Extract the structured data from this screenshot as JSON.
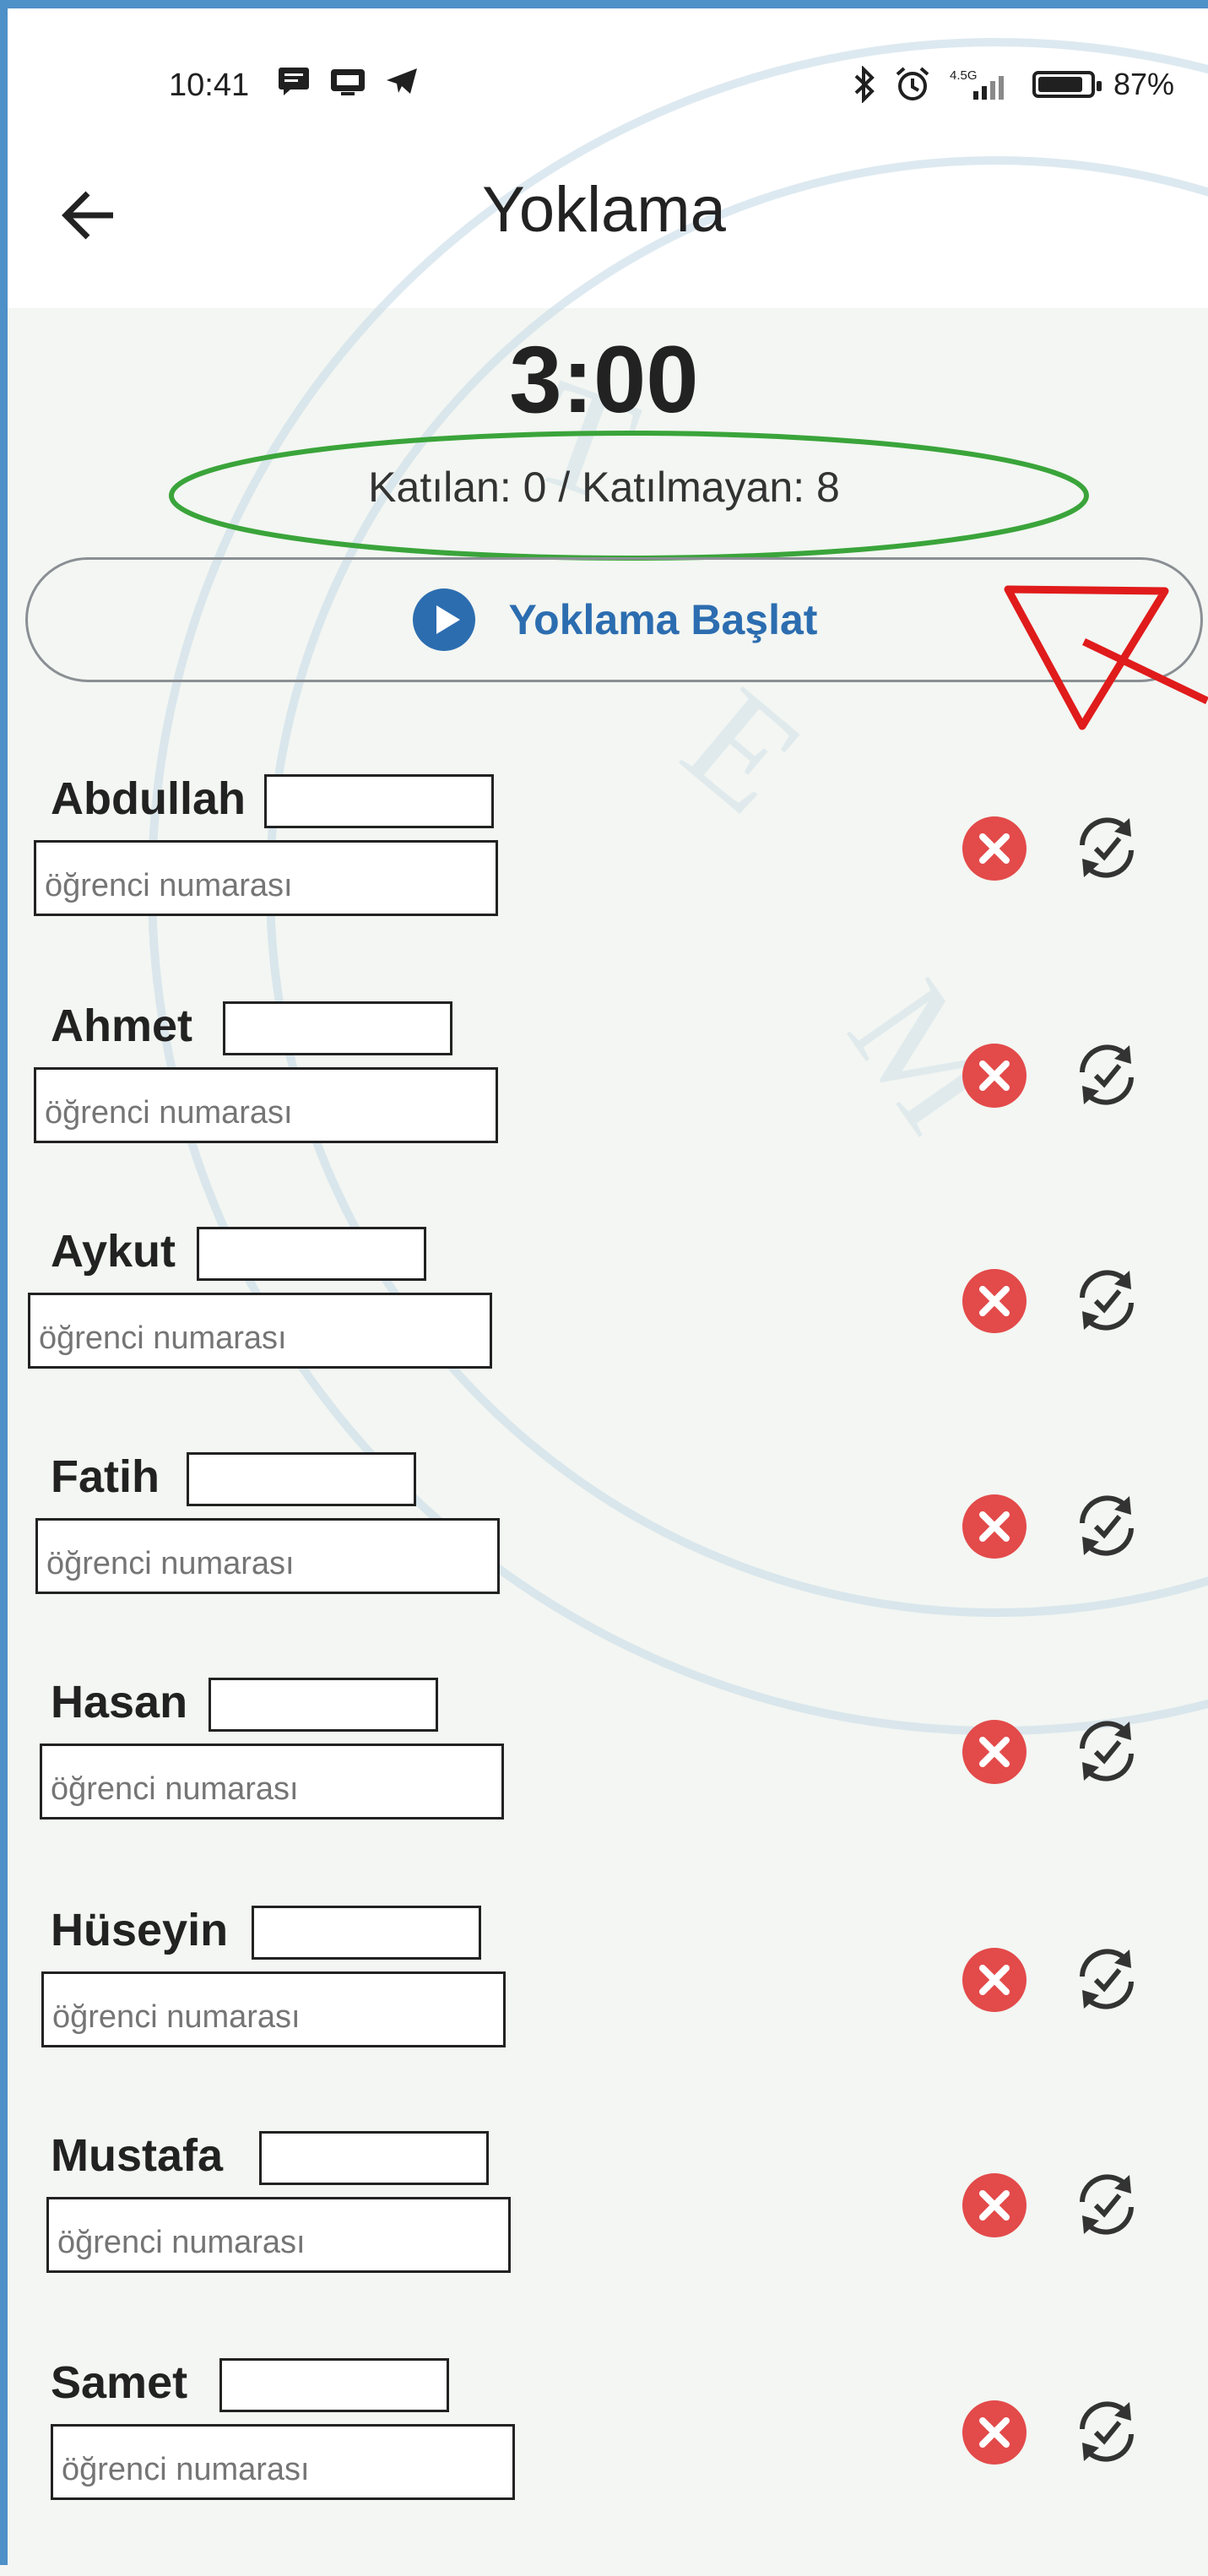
{
  "status_bar": {
    "time": "10:41",
    "left_icons": [
      "message-icon",
      "tv-icon",
      "telegram-icon"
    ],
    "right_icons": [
      "bluetooth-icon",
      "alarm-icon",
      "signal-icon",
      "battery-icon"
    ],
    "network": "4.5G",
    "battery_percent": "87%",
    "battery_level": 0.87
  },
  "header": {
    "back_icon": "arrow-left-icon",
    "title": "Yoklama"
  },
  "attendance": {
    "timer": "3:00",
    "summary": "Katılan: 0 / Katılmayan: 8",
    "start_button_label": "Yoklama Başlat",
    "start_icon": "play-circle-icon"
  },
  "students": [
    {
      "name": "Abdullah",
      "number_placeholder": "öğrenci numarası"
    },
    {
      "name": "Ahmet",
      "number_placeholder": "öğrenci numarası"
    },
    {
      "name": "Aykut",
      "number_placeholder": "öğrenci numarası"
    },
    {
      "name": "Fatih",
      "number_placeholder": "öğrenci numarası"
    },
    {
      "name": "Hasan",
      "number_placeholder": "öğrenci numarası"
    },
    {
      "name": "Hüseyin",
      "number_placeholder": "öğrenci numarası"
    },
    {
      "name": "Mustafa",
      "number_placeholder": "öğrenci numarası"
    },
    {
      "name": "Samet",
      "number_placeholder": "öğrenci numarası"
    }
  ],
  "row_icons": {
    "status": "absent-x-icon",
    "action": "sync-check-icon"
  },
  "colors": {
    "accent": "#2c6db0",
    "absent": "#e34a4a",
    "highlight_ellipse": "#3aa43a",
    "annotation_arrow": "#e01b1b",
    "frame": "#4e90c8"
  }
}
